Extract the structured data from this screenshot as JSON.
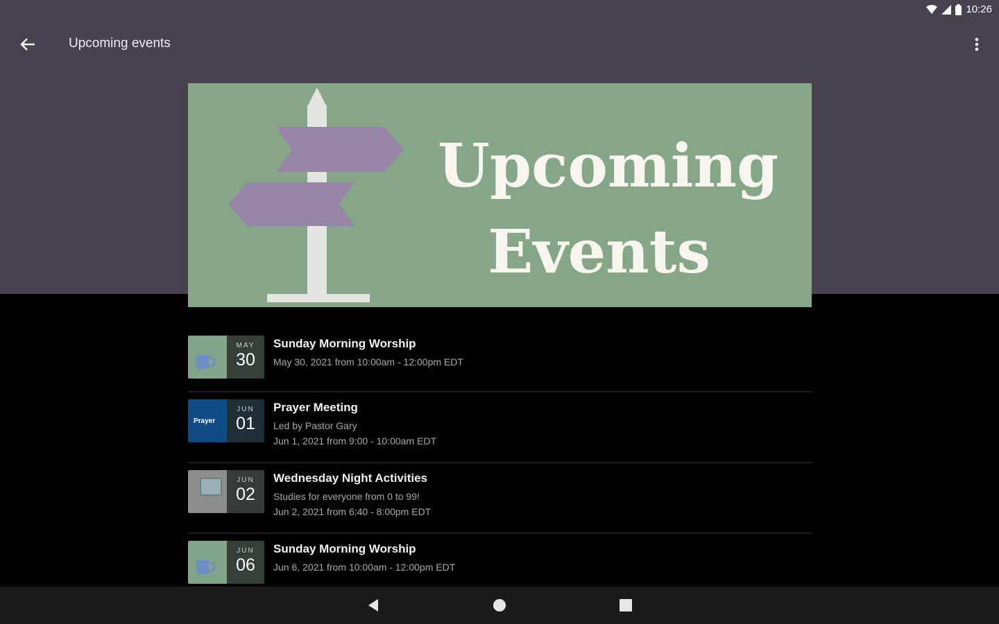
{
  "status_bar": {
    "time": "10:26"
  },
  "app_bar": {
    "title": "Upcoming events"
  },
  "banner": {
    "line1": "Upcoming",
    "line2": "Events"
  },
  "events": [
    {
      "month": "MAY",
      "day": "30",
      "thumb_text": "",
      "title": "Sunday Morning Worship",
      "details": [
        "May 30, 2021 from 10:00am - 12:00pm EDT"
      ]
    },
    {
      "month": "JUN",
      "day": "01",
      "thumb_text": "Prayer",
      "title": "Prayer Meeting",
      "details": [
        "Led by Pastor Gary",
        "Jun 1, 2021 from 9:00 - 10:00am EDT"
      ]
    },
    {
      "month": "JUN",
      "day": "02",
      "thumb_text": "",
      "title": "Wednesday Night Activities",
      "details": [
        "Studies for everyone from 0 to 99!",
        "Jun 2, 2021 from 6:40 - 8:00pm EDT"
      ]
    },
    {
      "month": "JUN",
      "day": "06",
      "thumb_text": "",
      "title": "Sunday Morning Worship",
      "details": [
        "Jun 6, 2021 from 10:00am - 12:00pm EDT"
      ]
    }
  ],
  "colors": {
    "header_bg": "#48424e",
    "banner_bg": "#86a68a",
    "arrow_purple": "#9785a8",
    "banner_text": "#f7f5ee"
  },
  "icons": {
    "back": "arrow-left-icon",
    "menu": "more-vert-icon",
    "nav_back": "triangle-back-icon",
    "nav_home": "circle-home-icon",
    "nav_recents": "square-recents-icon"
  }
}
